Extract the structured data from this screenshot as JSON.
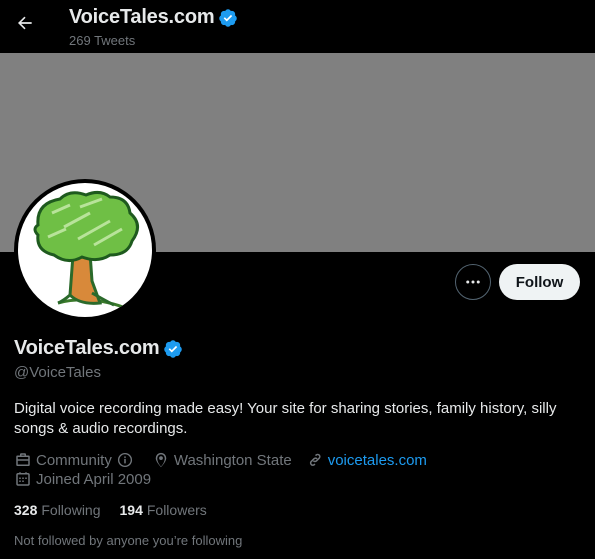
{
  "header": {
    "title": "VoiceTales.com",
    "tweet_count": "269 Tweets"
  },
  "profile": {
    "display_name": "VoiceTales.com",
    "handle": "@VoiceTales",
    "verified": true,
    "bio": "Digital voice recording made easy!  Your site for sharing stories, family history, silly songs & audio recordings.",
    "category": "Community",
    "location": "Washington State",
    "website": "voicetales.com",
    "joined": "Joined April 2009",
    "following_count": "328",
    "following_label": "Following",
    "followers_count": "194",
    "followers_label": "Followers",
    "mutuals_note": "Not followed by anyone you’re following"
  },
  "actions": {
    "follow_label": "Follow"
  },
  "colors": {
    "background": "#000000",
    "banner": "#808080",
    "verified": "#1d9bf0",
    "link": "#1d9bf0",
    "muted": "#71767b"
  }
}
